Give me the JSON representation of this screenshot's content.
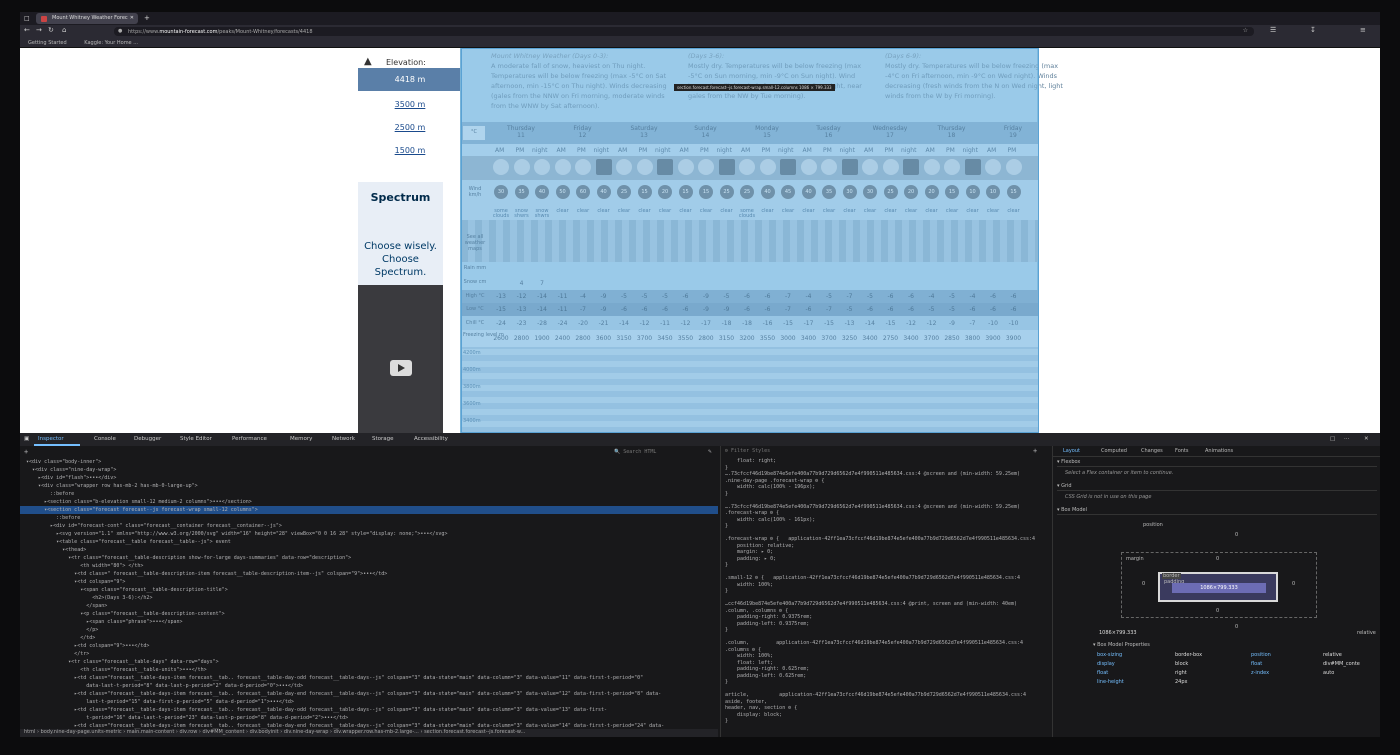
{
  "browser": {
    "tab_title": "Mount Whitney Weather Forec",
    "url_prefix": "https://www.",
    "url_domain": "mountain-forecast.com",
    "url_path": "/peaks/Mount-Whitney/forecasts/4418",
    "bookmarks": [
      "Getting Started",
      "Kaggle: Your Home ..."
    ]
  },
  "page": {
    "elevation_label": "Elevation:",
    "elevations": [
      "4418 m",
      "3500 m",
      "2500 m",
      "1500 m"
    ],
    "ad": {
      "brand": "Spectrum",
      "line1": "Choose wisely.",
      "line2": "Choose",
      "line3": "Spectrum."
    },
    "tooltip": "section.forecast.forecast--js.forecast-wrap.small-12.columns     1086 × 799.333",
    "descriptions": [
      {
        "title": "Mount Whitney Weather (Days 0-3):",
        "text": "A moderate fall of snow, heaviest on Thu night. Temperatures will be below freezing (max -5°C on Sat afternoon, min -15°C on Thu night). Winds decreasing (gales from the NNW on Fri morning, moderate winds from the WNW by Sat afternoon)."
      },
      {
        "title": "(Days 3-6):",
        "text": "Mostly dry. Temperatures will be below freezing (max -5°C on Sun morning, min -9°C on Sun night). Wind increasing (light winds from the W on Sun night, near gales from the NW by Tue morning)."
      },
      {
        "title": "(Days 6-9):",
        "text": "Mostly dry. Temperatures will be below freezing (max -4°C on Fri afternoon, min -9°C on Wed night). Winds decreasing (fresh winds from the N on Wed night, light winds from the W by Fri morning)."
      }
    ],
    "units": "°C",
    "days": [
      {
        "name": "Thursday",
        "num": "11"
      },
      {
        "name": "Friday",
        "num": "12"
      },
      {
        "name": "Saturday",
        "num": "13"
      },
      {
        "name": "Sunday",
        "num": "14"
      },
      {
        "name": "Monday",
        "num": "15"
      },
      {
        "name": "Tuesday",
        "num": "16"
      },
      {
        "name": "Wednesday",
        "num": "17"
      },
      {
        "name": "Thursday",
        "num": "18"
      },
      {
        "name": "Friday",
        "num": "19"
      }
    ],
    "periods": [
      "AM",
      "PM",
      "night"
    ],
    "winds": [
      "30",
      "35",
      "40",
      "50",
      "60",
      "40",
      "25",
      "15",
      "20",
      "15",
      "15",
      "25",
      "25",
      "40",
      "45",
      "40",
      "35",
      "30",
      "30",
      "25",
      "20",
      "20",
      "15",
      "10",
      "10",
      "15"
    ],
    "summaries": [
      "some clouds",
      "snow shwrs",
      "snow shwrs",
      "clear",
      "clear",
      "clear",
      "clear",
      "clear",
      "clear",
      "clear",
      "clear",
      "clear",
      "some clouds",
      "clear",
      "clear",
      "clear",
      "clear",
      "clear",
      "clear",
      "clear",
      "clear",
      "clear",
      "clear",
      "clear",
      "clear",
      "clear"
    ],
    "row_labels": {
      "wind": "Wind km/h",
      "see_all": "See all weather maps",
      "rain": "Rain mm",
      "snow": "Snow cm",
      "high": "High °C",
      "low": "Low °C",
      "chill": "Chill °C",
      "freezing": "Freezing level m"
    },
    "snow": [
      "",
      "4",
      "7",
      "",
      "",
      "",
      "",
      "",
      "",
      "",
      "",
      "",
      "",
      "",
      "",
      "",
      "",
      "",
      "",
      "",
      "",
      "",
      "",
      "",
      "",
      ""
    ],
    "high": [
      "-13",
      "-12",
      "-14",
      "-11",
      "-4",
      "-9",
      "-5",
      "-5",
      "-5",
      "-6",
      "-9",
      "-5",
      "-6",
      "-6",
      "-7",
      "-4",
      "-5",
      "-7",
      "-5",
      "-6",
      "-6",
      "-4",
      "-5",
      "-4",
      "-6",
      "-6"
    ],
    "low": [
      "-15",
      "-13",
      "-14",
      "-11",
      "-7",
      "-9",
      "-6",
      "-6",
      "-6",
      "-6",
      "-9",
      "-9",
      "-6",
      "-6",
      "-7",
      "-6",
      "-7",
      "-5",
      "-6",
      "-6",
      "-6",
      "-5",
      "-5",
      "-6",
      "-6",
      "-6"
    ],
    "chill": [
      "-24",
      "-23",
      "-28",
      "-24",
      "-20",
      "-21",
      "-14",
      "-12",
      "-11",
      "-12",
      "-17",
      "-18",
      "-18",
      "-16",
      "-15",
      "-17",
      "-15",
      "-13",
      "-14",
      "-15",
      "-12",
      "-12",
      "-9",
      "-7",
      "-10",
      "-10"
    ],
    "freezing": [
      "2600",
      "2800",
      "1900",
      "2400",
      "2800",
      "3600",
      "3150",
      "3700",
      "3450",
      "3550",
      "2800",
      "3150",
      "3200",
      "3550",
      "3000",
      "3400",
      "3700",
      "3250",
      "3400",
      "2750",
      "3400",
      "3700",
      "2850",
      "3800",
      "3900",
      "3900"
    ],
    "mountain_labels": [
      "4200m",
      "4000m",
      "3800m",
      "3600m",
      "3400m"
    ]
  },
  "devtools": {
    "tabs": [
      "Inspector",
      "Console",
      "Debugger",
      "Style Editor",
      "Performance",
      "Memory",
      "Network",
      "Storage",
      "Accessibility"
    ],
    "search_placeholder": "Search HTML",
    "markup_lines": [
      "  ▾<div class=\"body-inner\">",
      "    ▾<div class=\"nine-day-wrap\">",
      "      ▸<div id=\"flash\">•••</div>",
      "      ▾<div class=\"wrapper row has-mb-2 has-mb-0-large-up\">",
      "          ::before",
      "        ▸<section class=\"b-elevation small-12 medium-2 columns\">•••</section>",
      "        ▾<section class=\"forecast forecast--js forecast-wrap small-12 columns\">",
      "            ::before",
      "          ▸<div id=\"forecast-cont\" class=\"forecast__container forecast__container--js\">",
      "            ▸<svg version=\"1.1\" xmlns=\"http://www.w3.org/2000/svg\" width=\"16\" height=\"28\" viewBox=\"0 0 16 28\" style=\"display: none;\">•••</svg>",
      "            ▾<table class=\"forecast__table forecast__table--js\"> event",
      "              ▾<thead>",
      "                ▾<tr class=\"forecast__table-description show-for-large days-summaries\" data-row=\"description\">",
      "                    <th width=\"80\"> </th>",
      "                  ▾<td class=\" forecast__table-description-item forecast__table-description-item--js\" colspan=\"9\">•••</td>",
      "                  ▾<td colspan=\"9\">",
      "                    ▾<span class=\"forecast__table-description-title\">",
      "                        <h2>(Days 3-6):</h2>",
      "                      </span>",
      "                    ▾<p class=\"forecast__table-description-content\">",
      "                      ▸<span class=\"phrase\">•••</span>",
      "                      </p>",
      "                    </td>",
      "                  ▸<td colspan=\"9\">•••</td>",
      "                  </tr>",
      "                ▾<tr class=\"forecast__table-days\" data-row=\"days\">",
      "                    <th class=\"forecast__table-units\">•••</th>",
      "                  ▸<td class=\"forecast__table-days-item forecast__tab.. forecast__table-day-odd forecast__table-days--js\" colspan=\"3\" data-state=\"main\" data-column=\"3\" data-value=\"11\" data-first-t-period=\"0\"",
      "                      data-last-t-period=\"8\" data-last-p-period=\"2\" data-d-period=\"0\">•••</td>",
      "                  ▸<td class=\"forecast__table-days-item forecast__tab.. forecast__table-day-end forecast__table-days--js\" colspan=\"3\" data-state=\"main\" data-column=\"3\" data-value=\"12\" data-first-t-period=\"8\" data-",
      "                      last-t-period=\"15\" data-first-p-period=\"5\" data-d-period=\"1\">•••</td>",
      "                  ▸<td class=\"forecast__table-days-item forecast__tab.. forecast__table-day-odd forecast__table-days--js\" colspan=\"3\" data-state=\"main\" data-column=\"3\" data-value=\"13\" data-first-",
      "                      t-period=\"16\" data-last-t-period=\"23\" data-last-p-period=\"8\" data-d-period=\"2\">•••</td>",
      "                  ▸<td class=\"forecast__table-days-item forecast__tab.. forecast__table-day-end forecast__table-days--js\" colspan=\"3\" data-state=\"main\" data-column=\"3\" data-value=\"14\" data-first-t-period=\"24\" data-"
    ],
    "selected_line": 6,
    "breadcrumbs": "html  ›  body.nine-day-page.units-metric  ›  main.main-content  ›  div.row  ›  div#MM_content  ›  div.bodyinit  ›  div.nine-day-wrap  ›  div.wrapper.row.has-mb-2.large-...  ›  section.forecast.forecast--js.forecast-w...",
    "filter_placeholder": "Filter Styles",
    "rules_lines": [
      "    float: right;",
      "}",
      "….73cfccf46d19be874e5efe400a77b9d729d6562d7e4f990511e485634.css:4 @screen and (min-width: 59.25em)",
      ".nine-day-page .forecast-wrap ⚙ {",
      "    width: calc(100% - 196px);",
      "}",
      "",
      "….73cfccf46d19be874e5efe400a77b9d729d6562d7e4f990511e485634.css:4 @screen and (min-width: 59.25em)",
      ".forecast-wrap ⚙ {",
      "    width: calc(100% - 161px);",
      "}",
      "",
      ".forecast-wrap ⚙ {   application-42ff1ea73cfccf46d19be874e5efe400a77b9d729d6562d7e4f990511e485634.css:4",
      "    position: relative;",
      "    margin: ▸ 0;",
      "    padding: ▸ 0;",
      "}",
      "",
      ".small-12 ⚙ {   application-42ff1ea73cfccf46d19be874e5efe400a77b9d729d6562d7e4f990511e485634.css:4",
      "    width: 100%;",
      "}",
      "",
      "…ccf46d19be874e5efe400a77b9d729d6562d7e4f990511e485634.css:4 @print, screen and (min-width: 40em)",
      ".column, .columns ⚙ {",
      "    padding-right: 0.9375rem;",
      "    padding-left: 0.9375rem;",
      "}",
      "",
      ".column,         application-42ff1ea73cfccf46d19be874e5efe400a77b9d729d6562d7e4f990511e485634.css:4",
      ".columns ⚙ {",
      "    width: 100%;",
      "    float: left;",
      "    padding-right: 0.625rem;",
      "    padding-left: 0.625rem;",
      "}",
      "",
      "article,          application-42ff1ea73cfccf46d19be874e5efe400a77b9d729d6562d7e4f990511e485634.css:4",
      "aside, footer,",
      "header, nav, section ⚙ {",
      "    display: block;",
      "}"
    ],
    "layout_tabs": [
      "Layout",
      "Computed",
      "Changes",
      "Fonts",
      "Animations"
    ],
    "flexbox_title": "Flexbox",
    "flexbox_text": "Select a Flex container or item to continue.",
    "grid_title": "Grid",
    "grid_text": "CSS Grid is not in use on this page",
    "boxmodel_title": "Box Model",
    "box": {
      "position": "position",
      "margin": "margin",
      "border": "border",
      "padding": "padding",
      "content": "1086×799.333",
      "zero": "0",
      "size": "1086×799.333",
      "pos_value": "relative"
    },
    "props_title": "Box Model Properties",
    "props": [
      [
        "box-sizing",
        "border-box",
        "position",
        "relative"
      ],
      [
        "display",
        "block",
        "float",
        "div#MM_conte"
      ],
      [
        "float",
        "right",
        "z-index",
        "auto"
      ],
      [
        "line-height",
        "24px",
        "",
        ""
      ]
    ]
  }
}
